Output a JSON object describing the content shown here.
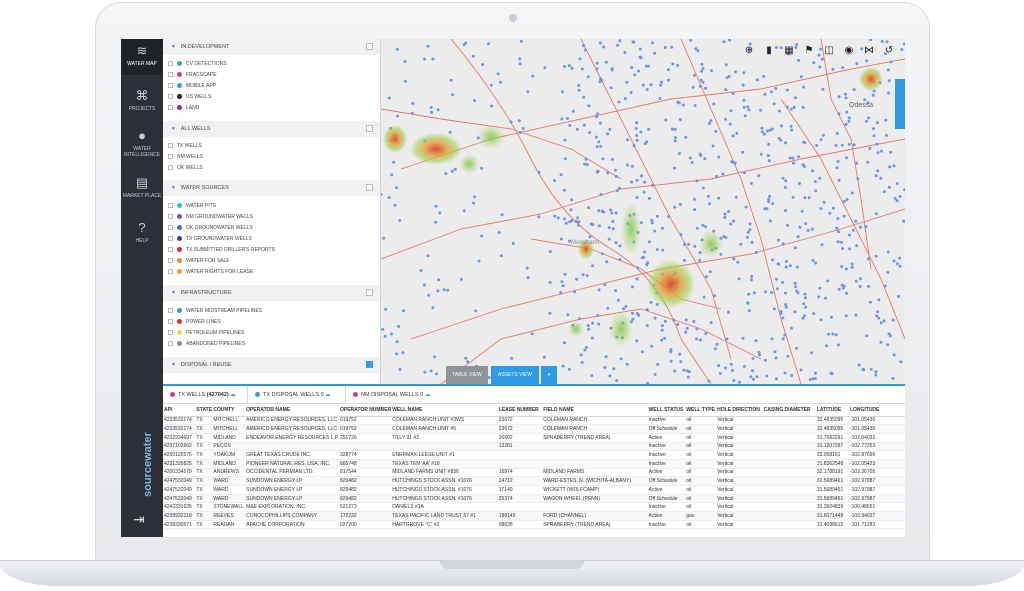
{
  "colors": {
    "accent": "#2e9ae6",
    "nav_bg": "#2c3036",
    "well_dot": "#6f95e8",
    "fault_line": "#e37a6a",
    "heat_hot": "#d44a28",
    "heat_warm": "#9fd14b"
  },
  "nav": {
    "items": [
      {
        "label": "WATER MAP",
        "icon": "layers-icon"
      },
      {
        "label": "PROJECTS",
        "icon": "network-icon"
      },
      {
        "label": "WATER INTELLIGENCE",
        "icon": "water-drop-icon"
      },
      {
        "label": "MARKET PLACE",
        "icon": "map-icon"
      },
      {
        "label": "HELP",
        "icon": "help-icon"
      }
    ],
    "brand": "sourcewater"
  },
  "layers": {
    "groups": [
      {
        "title": "IN DEVELOPMENT",
        "checked": false,
        "items": [
          {
            "label": "CV DETECTIONS",
            "color": "#2db87a"
          },
          {
            "label": "FRACSCAPE",
            "color": "#d43ca0"
          },
          {
            "label": "MOBILE APP",
            "color": "#23a6d6"
          },
          {
            "label": "US WELLS",
            "color": "#222222"
          },
          {
            "label": "LAND",
            "color": "#8a2f8e"
          }
        ]
      },
      {
        "title": "ALL WELLS",
        "checked": false,
        "items": [
          {
            "label": "TX WELLS"
          },
          {
            "label": "NM WELLS"
          },
          {
            "label": "OK WELLS"
          }
        ]
      },
      {
        "title": "WATER SOURCES",
        "checked": false,
        "items": [
          {
            "label": "WATER PITS",
            "color": "#2cc0c4"
          },
          {
            "label": "NM GROUNDWATER WELLS",
            "color": "#7b4bd1"
          },
          {
            "label": "OK GROUNDWATER WELLS",
            "color": "#2f6fd6"
          },
          {
            "label": "TX GROUNDWATER WELLS",
            "color": "#3040a8"
          },
          {
            "label": "TX SUBMITTED DRILLER'S REPORTS",
            "color": "#d42a4a"
          },
          {
            "label": "WATER FOR SALE",
            "color": "#e28a2a"
          },
          {
            "label": "WATER RIGHTS FOR LEASE",
            "color": "#f0a12a"
          }
        ]
      },
      {
        "title": "INFRASTRUCTURE",
        "checked": false,
        "items": [
          {
            "label": "WATER MIDSTREAM PIPELINES",
            "color": "#2b9bd6"
          },
          {
            "label": "POWER LINES",
            "color": "#d63030"
          },
          {
            "label": "PETROLEUM PIPELINES",
            "color": "#e8d84a"
          },
          {
            "label": "ABANDONED PIPELINES",
            "color": "#8a8f95"
          }
        ]
      },
      {
        "title": "DISPOSAL / REUSE",
        "checked": true,
        "items": []
      }
    ]
  },
  "map": {
    "toolbar": [
      "zoom-icon",
      "bookmark-icon",
      "grid-icon",
      "flag-icon",
      "crop-icon",
      "target-icon",
      "share-icon",
      "history-icon"
    ],
    "labels": [
      "Odessa",
      "Monahans"
    ],
    "view_buttons": {
      "table": "TABLE VIEW",
      "assets": "ASSETS VIEW"
    }
  },
  "tabs": [
    {
      "label": "TX WELLS",
      "count": "(427042)",
      "color": "#d43ca0"
    },
    {
      "label": "TX DISPOSAL WELLS",
      "count": "0",
      "color": "#23a6d6"
    },
    {
      "label": "NM DISPOSAL WELLS",
      "count": "0",
      "color": "#d43ca0"
    }
  ],
  "table": {
    "columns": [
      "API",
      "STATE",
      "COUNTY",
      "OPERATOR NAME",
      "OPERATOR NUMBER",
      "WELL NAME",
      "LEASE NUMBER",
      "FIELD NAME",
      "WELL STATUS",
      "WELL TYPE",
      "HOLE DIRECTION",
      "CASING DIAMETER",
      "LATITUDE",
      "LONGITUDE"
    ],
    "rows": [
      [
        "4233532174",
        "TX",
        "MITCHELL",
        "AMERICO ENERGY RESOURCES, LLC",
        "019752",
        "COLEMAN RANCH UNIT #3WS",
        "23672",
        "COLEMAN RANCH",
        "Inactive",
        "oil",
        "Vertical",
        "",
        "32.4835095",
        "-101.05430"
      ],
      [
        "4233532174",
        "TX",
        "MITCHELL",
        "AMERICO ENERGY RESOURCES, LLC",
        "019752",
        "COLEMAN RANCH UNIT #5",
        "23672",
        "COLEMAN RANCH",
        "Off Schedule",
        "oil",
        "Vertical",
        "",
        "32.4835095",
        "-101.05430"
      ],
      [
        "4232934697",
        "TX",
        "MIDLAND",
        "ENDEAVOR ENERGY RESOURCES L.P.",
        "251726",
        "TILLY 31 #2",
        "26602",
        "SPRABERRY (TREND AREA)",
        "Active",
        "oil",
        "Vertical",
        "",
        "31.7682291",
        "-102.04032"
      ],
      [
        "4237102662",
        "TX",
        "PECOS",
        "",
        "",
        "",
        "13281",
        "",
        "Inactive",
        "oil",
        "Vertical",
        "",
        "31.1207297",
        "-102.77253"
      ],
      [
        "4250125576",
        "TX",
        "YOAKUM",
        "GREAT TEXAS CRUDE INC.",
        "328774",
        "ENERMAX-LEESE UNIT #1",
        "",
        "",
        "Inactive",
        "oil",
        "Vertical",
        "",
        "33.058161",
        "-102.87696"
      ],
      [
        "4231335825",
        "TX",
        "MIDLAND",
        "PIONEER NATURAL RES. USA, INC.",
        "665748",
        "TEXAS TEN 'AA' #18",
        "",
        "",
        "Inactive",
        "oil",
        "Vertical",
        "",
        "31.8362548",
        "-102.05423"
      ],
      [
        "4200334579",
        "TX",
        "ANDREWS",
        "OCCIDENTAL PERMIAN LTD.",
        "817544",
        "MIDLAND FARMS UNIT #836",
        "16874",
        "MIDLAND FARMS",
        "Active",
        "oil",
        "Vertical",
        "",
        "32.1788191",
        "-102.36705"
      ],
      [
        "4247532049",
        "TX",
        "WARD",
        "SUNDOWN ENERGY LP",
        "829482",
        "HUTCHINGS STOCK ASSN. #1076",
        "24712",
        "WARD-ESTES, N. (WICHITA-ALBANY)",
        "Off Schedule",
        "oil",
        "Vertical",
        "",
        "31.5689461",
        "-102.97987"
      ],
      [
        "4247532049",
        "TX",
        "WARD",
        "SUNDOWN ENERGY LP",
        "829482",
        "HUTCHINGS STOCK ASSN. #1076",
        "17149",
        "WICKETT (WOLFCAMP)",
        "Active",
        "oil",
        "Vertical",
        "",
        "31.5689461",
        "-102.97987"
      ],
      [
        "4247532049",
        "TX",
        "WARD",
        "SUNDOWN ENERGY LP",
        "829482",
        "HUTCHINGS STOCK ASSN. #1076",
        "25374",
        "WAGON WHEEL (PENN)",
        "Off Schedule",
        "oil",
        "Vertical",
        "",
        "31.5689461",
        "-102.97987"
      ],
      [
        "4243331635",
        "TX",
        "STONEWALL",
        "M&E EXPLORATION, INC.",
        "521273",
        "DANIELS #1A",
        "",
        "",
        "Inactive",
        "oil",
        "Vertical",
        "",
        "33.2604839",
        "-100.48651"
      ],
      [
        "4238932218",
        "TX",
        "REEVES",
        "CONOCOPHILLIPS COMPANY",
        "172232",
        "TEXAS PACIFIC LAND TRUST 57 #1",
        "188149",
        "FORD (CHANNEL)",
        "Active",
        "gas",
        "Vertical",
        "",
        "31.6071448",
        "-103.94027"
      ],
      [
        "4238330571",
        "TX",
        "REAGAN",
        "APACHE CORPORATION",
        "027200",
        "HARTGROVE \"C\" #2",
        "08628",
        "SPRABERRY (TREND AREA)",
        "Inactive",
        "oil",
        "Vertical",
        "",
        "31.4098615",
        "-101.71283"
      ]
    ]
  }
}
